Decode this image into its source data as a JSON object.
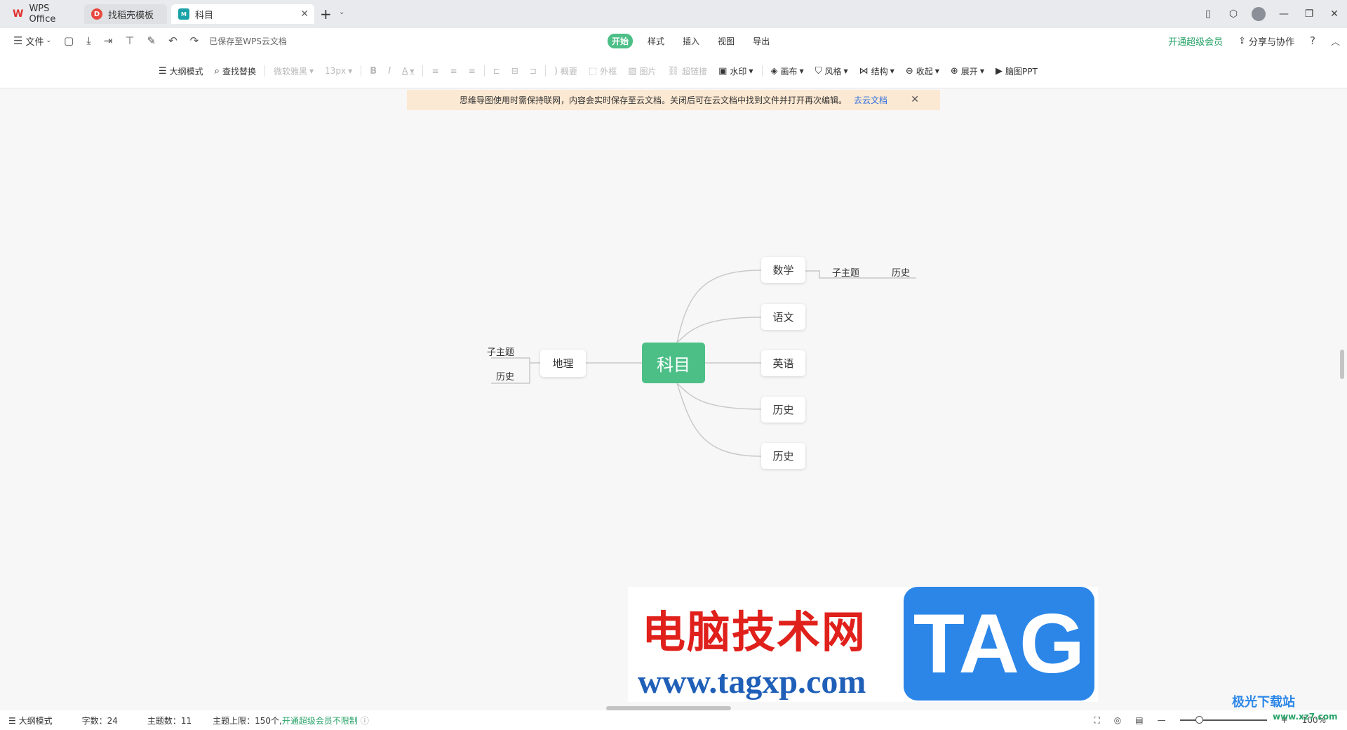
{
  "tabs": [
    {
      "label": "WPS Office",
      "icon": "wps-logo-icon"
    },
    {
      "label": "找稻壳模板",
      "icon": "docer-icon"
    },
    {
      "label": "科目",
      "icon": "mindmap-doc-icon"
    }
  ],
  "menubar": {
    "file_label": "文件",
    "saved_status": "已保存至WPS云文档",
    "tabs": [
      "开始",
      "样式",
      "插入",
      "视图",
      "导出"
    ],
    "vip_label": "开通超级会员",
    "share_label": "分享与协作",
    "help": "?"
  },
  "toolbar": {
    "outline_mode": "大纲模式",
    "find_replace": "查找替换",
    "font": "微软雅黑",
    "size": "13px",
    "bold": "B",
    "italic": "I",
    "font_color": "A",
    "summary": "概要",
    "frame": "外框",
    "image": "图片",
    "link": "超链接",
    "watermark": "水印",
    "canvas": "画布",
    "style": "风格",
    "structure": "结构",
    "collapse": "收起",
    "expand": "展开",
    "ppt": "脑图PPT"
  },
  "notice": {
    "text": "思维导图使用时需保持联网，内容会实时保存至云文档。关闭后可在云文档中找到文件并打开再次编辑。",
    "link": "去云文档"
  },
  "mindmap": {
    "root": "科目",
    "right_nodes": [
      "数学",
      "语文",
      "英语",
      "历史",
      "历史"
    ],
    "math_children": [
      "子主题",
      "历史"
    ],
    "left_node": "地理",
    "left_children": [
      "子主题",
      "历史"
    ]
  },
  "watermark": {
    "cn_text": "电脑技术网",
    "url": "www.tagxp.com",
    "tag": "TAG"
  },
  "statusbar": {
    "outline_mode": "大纲模式",
    "word_count": "字数：24",
    "topic_count": "主题数：11",
    "topic_limit": "主题上限：150个,",
    "vip_unlimited": "开通超级会员不限制",
    "zoom": "100%"
  },
  "corner_brand": {
    "name": "极光下载站",
    "url": "www.xz7.com"
  },
  "colors": {
    "accent": "#4cbf87",
    "notice_bg": "#fce9d3",
    "link": "#2f6fdb",
    "vip": "#29a369"
  }
}
